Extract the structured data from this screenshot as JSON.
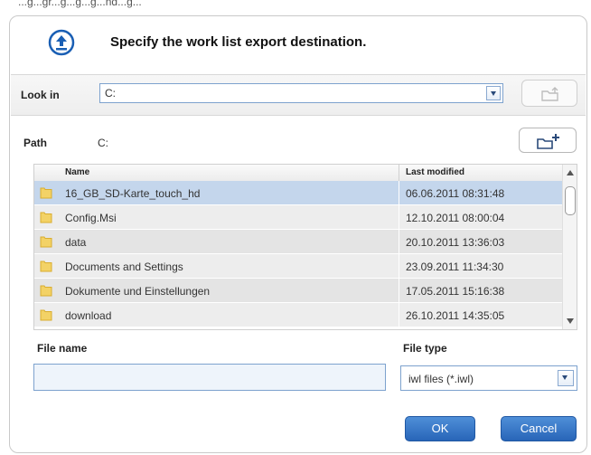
{
  "top_clipped_text": "...g...gr...g...g...g...nd...g...",
  "dialog": {
    "title": "Specify the work list export destination."
  },
  "look_in": {
    "label": "Look in",
    "value": "C:"
  },
  "path": {
    "label": "Path",
    "value": "C:"
  },
  "file_list": {
    "columns": [
      "Name",
      "Last modified"
    ],
    "rows": [
      {
        "name": "16_GB_SD-Karte_touch_hd",
        "modified": "06.06.2011 08:31:48",
        "selected": true
      },
      {
        "name": "Config.Msi",
        "modified": "12.10.2011 08:00:04",
        "selected": false
      },
      {
        "name": "data",
        "modified": "20.10.2011 13:36:03",
        "selected": false
      },
      {
        "name": "Documents and Settings",
        "modified": "23.09.2011 11:34:30",
        "selected": false
      },
      {
        "name": "Dokumente und Einstellungen",
        "modified": "17.05.2011 15:16:38",
        "selected": false
      },
      {
        "name": "download",
        "modified": "26.10.2011 14:35:05",
        "selected": false
      }
    ]
  },
  "file_name": {
    "label": "File name",
    "value": ""
  },
  "file_type": {
    "label": "File type",
    "value": "iwl files (*.iwl)"
  },
  "buttons": {
    "ok": "OK",
    "cancel": "Cancel"
  },
  "colors": {
    "accent": "#2865b8",
    "selected_row": "#c4d6ec",
    "icon_blue": "#1a5fb4",
    "folder_yellow": "#f3d266"
  },
  "icons": [
    "export-upload-icon",
    "up-folder-icon",
    "new-folder-icon",
    "folder-icon",
    "chevron-down-icon"
  ]
}
